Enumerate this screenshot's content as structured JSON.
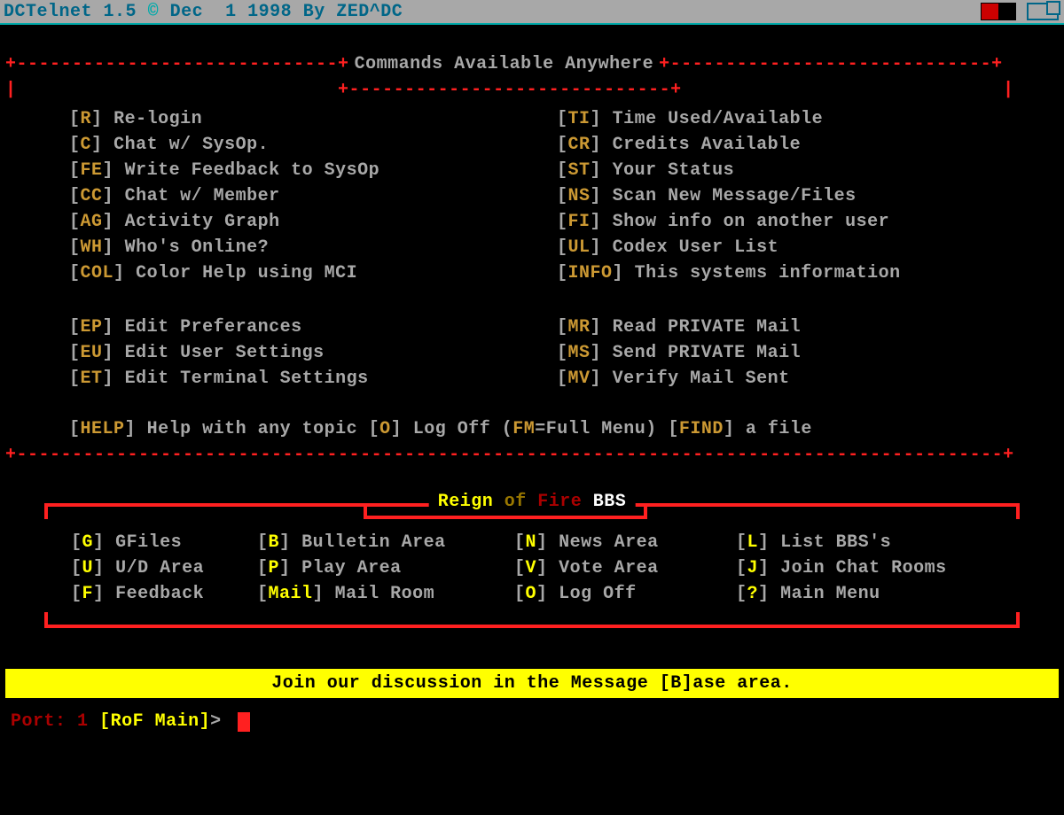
{
  "titlebar": {
    "app": "DCTelnet",
    "version": "1.5",
    "copyright": "©",
    "date_month": "Dec",
    "date_day": "1",
    "date_year": "1998",
    "by": "By",
    "author": "ZED^DC"
  },
  "commands_box": {
    "title": "Commands Available Anywhere",
    "left": [
      {
        "key": "R",
        "label": "Re-login"
      },
      {
        "key": "C",
        "label": "Chat w/ SysOp."
      },
      {
        "key": "FE",
        "label": "Write Feedback to SysOp"
      },
      {
        "key": "CC",
        "label": "Chat w/ Member"
      },
      {
        "key": "AG",
        "label": "Activity Graph"
      },
      {
        "key": "WH",
        "label": "Who's Online?"
      },
      {
        "key": "COL",
        "label": "Color Help using MCI"
      }
    ],
    "right": [
      {
        "key": "TI",
        "label": "Time Used/Available"
      },
      {
        "key": "CR",
        "label": "Credits Available"
      },
      {
        "key": "ST",
        "label": "Your Status"
      },
      {
        "key": "NS",
        "label": "Scan New Message/Files"
      },
      {
        "key": "FI",
        "label": "Show info on another user"
      },
      {
        "key": "UL",
        "label": "Codex User List"
      },
      {
        "key": "INFO",
        "label": "This systems information"
      }
    ],
    "left2": [
      {
        "key": "EP",
        "label": "Edit Preferances"
      },
      {
        "key": "EU",
        "label": "Edit User Settings"
      },
      {
        "key": "ET",
        "label": "Edit Terminal Settings"
      }
    ],
    "right2": [
      {
        "key": "MR",
        "label": "Read PRIVATE Mail"
      },
      {
        "key": "MS",
        "label": "Send PRIVATE Mail"
      },
      {
        "key": "MV",
        "label": "Verify Mail Sent"
      }
    ],
    "footer": {
      "help_key": "HELP",
      "help_label": "Help with any topic",
      "logoff_key": "O",
      "logoff_label": "Log Off",
      "fm_key": "FM",
      "fm_label": "=Full Menu",
      "find_key": "FIND",
      "find_label": "a file"
    }
  },
  "bbs_box": {
    "title_word1": "Reign",
    "title_word2": "of",
    "title_word3": "Fire",
    "title_word4": "BBS",
    "items": [
      {
        "key": "G",
        "label": "GFiles"
      },
      {
        "key": "B",
        "label": "Bulletin Area"
      },
      {
        "key": "N",
        "label": "News Area"
      },
      {
        "key": "L",
        "label": "List BBS's"
      },
      {
        "key": "U",
        "label": "U/D Area"
      },
      {
        "key": "P",
        "label": "Play Area"
      },
      {
        "key": "V",
        "label": "Vote Area"
      },
      {
        "key": "J",
        "label": "Join Chat Rooms"
      },
      {
        "key": "F",
        "label": "Feedback"
      },
      {
        "key": "Mail",
        "label": "Mail Room"
      },
      {
        "key": "O",
        "label": "Log Off"
      },
      {
        "key": "?",
        "label": "Main Menu"
      }
    ]
  },
  "banner": "Join our discussion in the Message [B]ase area.",
  "prompt": {
    "port_label": "Port:",
    "port_num": "1",
    "context": "RoF Main",
    "gt": ">"
  }
}
